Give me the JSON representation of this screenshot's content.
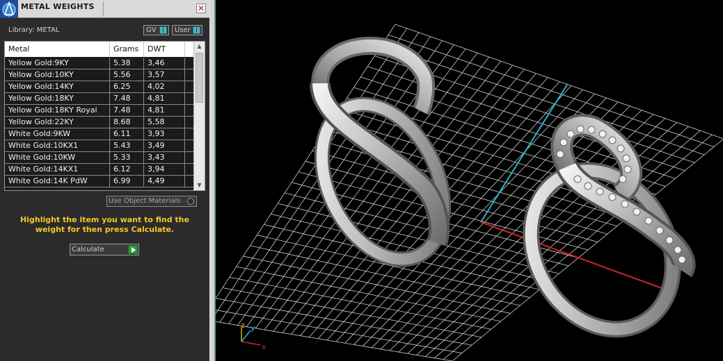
{
  "panel": {
    "title": "METAL WEIGHTS",
    "close_glyph": "✕",
    "library_label": "Library: METAL",
    "toggles": {
      "gv_label": "GV",
      "user_label": "User"
    },
    "table": {
      "headers": {
        "metal": "Metal",
        "grams": "Grams",
        "dwt": "DWT"
      },
      "rows": [
        {
          "metal": "Yellow Gold:9KY",
          "grams": "5.38",
          "dwt": "3,46"
        },
        {
          "metal": "Yellow Gold:10KY",
          "grams": "5.56",
          "dwt": "3,57"
        },
        {
          "metal": "Yellow Gold:14KY",
          "grams": "6.25",
          "dwt": "4,02"
        },
        {
          "metal": "Yellow Gold:18KY",
          "grams": "7.48",
          "dwt": "4,81"
        },
        {
          "metal": "Yellow Gold:18KY Royal",
          "grams": "7.48",
          "dwt": "4,81"
        },
        {
          "metal": "Yellow Gold:22KY",
          "grams": "8.68",
          "dwt": "5,58"
        },
        {
          "metal": "White Gold:9KW",
          "grams": "6.11",
          "dwt": "3,93"
        },
        {
          "metal": "White Gold:10KX1",
          "grams": "5.43",
          "dwt": "3,49"
        },
        {
          "metal": "White Gold:10KW",
          "grams": "5.33",
          "dwt": "3,43"
        },
        {
          "metal": "White Gold:14KX1",
          "grams": "6.12",
          "dwt": "3,94"
        },
        {
          "metal": "White Gold:14K PdW",
          "grams": "6.99",
          "dwt": "4,49"
        }
      ]
    },
    "use_object_materials": "Use Object Materials",
    "hint": "Highlight the item you want to find the weight for then press Calculate.",
    "calculate_label": "Calculate"
  },
  "viewport": {
    "axis_labels": {
      "z": "z",
      "y": "y",
      "x": "x"
    }
  },
  "colors": {
    "panel_bg": "#2b2b2b",
    "hint_text": "#f2c92a",
    "grid": "#cfcfcf",
    "axis_x": "#d0232a",
    "axis_y": "#2fb4c8"
  }
}
